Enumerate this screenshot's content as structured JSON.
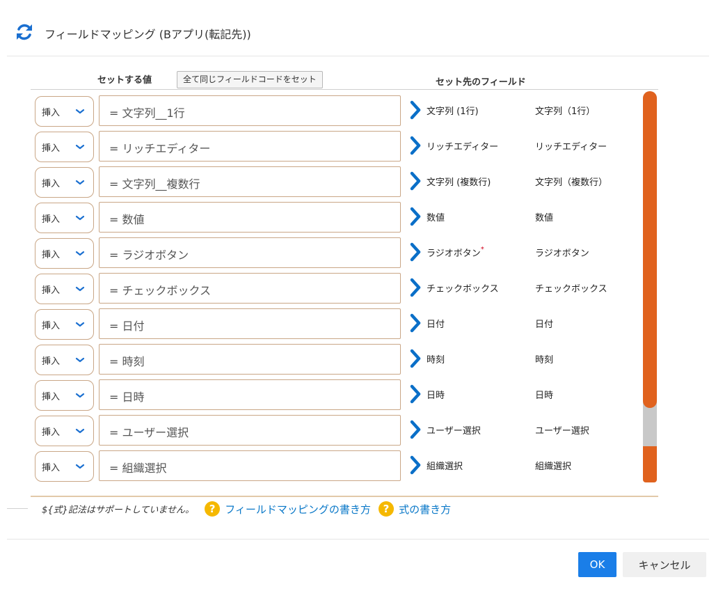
{
  "dialog": {
    "title": "フィールドマッピング (Bアプリ(転記先))",
    "icon": "sync-icon",
    "accent_color": "#1a7ee8",
    "scrollbar_color": "#e0621e"
  },
  "columns": {
    "value_header": "セットする値",
    "set_all_button": "全て同じフィールドコードをセット",
    "target_header": "セット先のフィールド"
  },
  "rows": [
    {
      "mode": "挿入",
      "value": "= 文字列__1行",
      "target_label": "文字列 (1行)",
      "required": "",
      "target_code": "文字列（1行）"
    },
    {
      "mode": "挿入",
      "value": "= リッチエディター",
      "target_label": "リッチエディター",
      "required": "",
      "target_code": "リッチエディター"
    },
    {
      "mode": "挿入",
      "value": "= 文字列__複数行",
      "target_label": "文字列 (複数行)",
      "required": "",
      "target_code": "文字列（複数行）"
    },
    {
      "mode": "挿入",
      "value": "= 数値",
      "target_label": "数値",
      "required": "",
      "target_code": "数値"
    },
    {
      "mode": "挿入",
      "value": "= ラジオボタン",
      "target_label": "ラジオボタン",
      "required": "*",
      "target_code": "ラジオボタン"
    },
    {
      "mode": "挿入",
      "value": "= チェックボックス",
      "target_label": "チェックボックス",
      "required": "",
      "target_code": "チェックボックス"
    },
    {
      "mode": "挿入",
      "value": "= 日付",
      "target_label": "日付",
      "required": "",
      "target_code": "日付"
    },
    {
      "mode": "挿入",
      "value": "= 時刻",
      "target_label": "時刻",
      "required": "",
      "target_code": "時刻"
    },
    {
      "mode": "挿入",
      "value": "= 日時",
      "target_label": "日時",
      "required": "",
      "target_code": "日時"
    },
    {
      "mode": "挿入",
      "value": "= ユーザー選択",
      "target_label": "ユーザー選択",
      "required": "",
      "target_code": "ユーザー選択"
    },
    {
      "mode": "挿入",
      "value": "= 組織選択",
      "target_label": "組織選択",
      "required": "",
      "target_code": "組織選択"
    }
  ],
  "note": {
    "text": "${式}記法はサポートしていません。",
    "help_icon_glyph": "?",
    "link1": "フィールドマッピングの書き方",
    "link2": "式の書き方"
  },
  "footer": {
    "ok_label": "OK",
    "cancel_label": "キャンセル"
  }
}
